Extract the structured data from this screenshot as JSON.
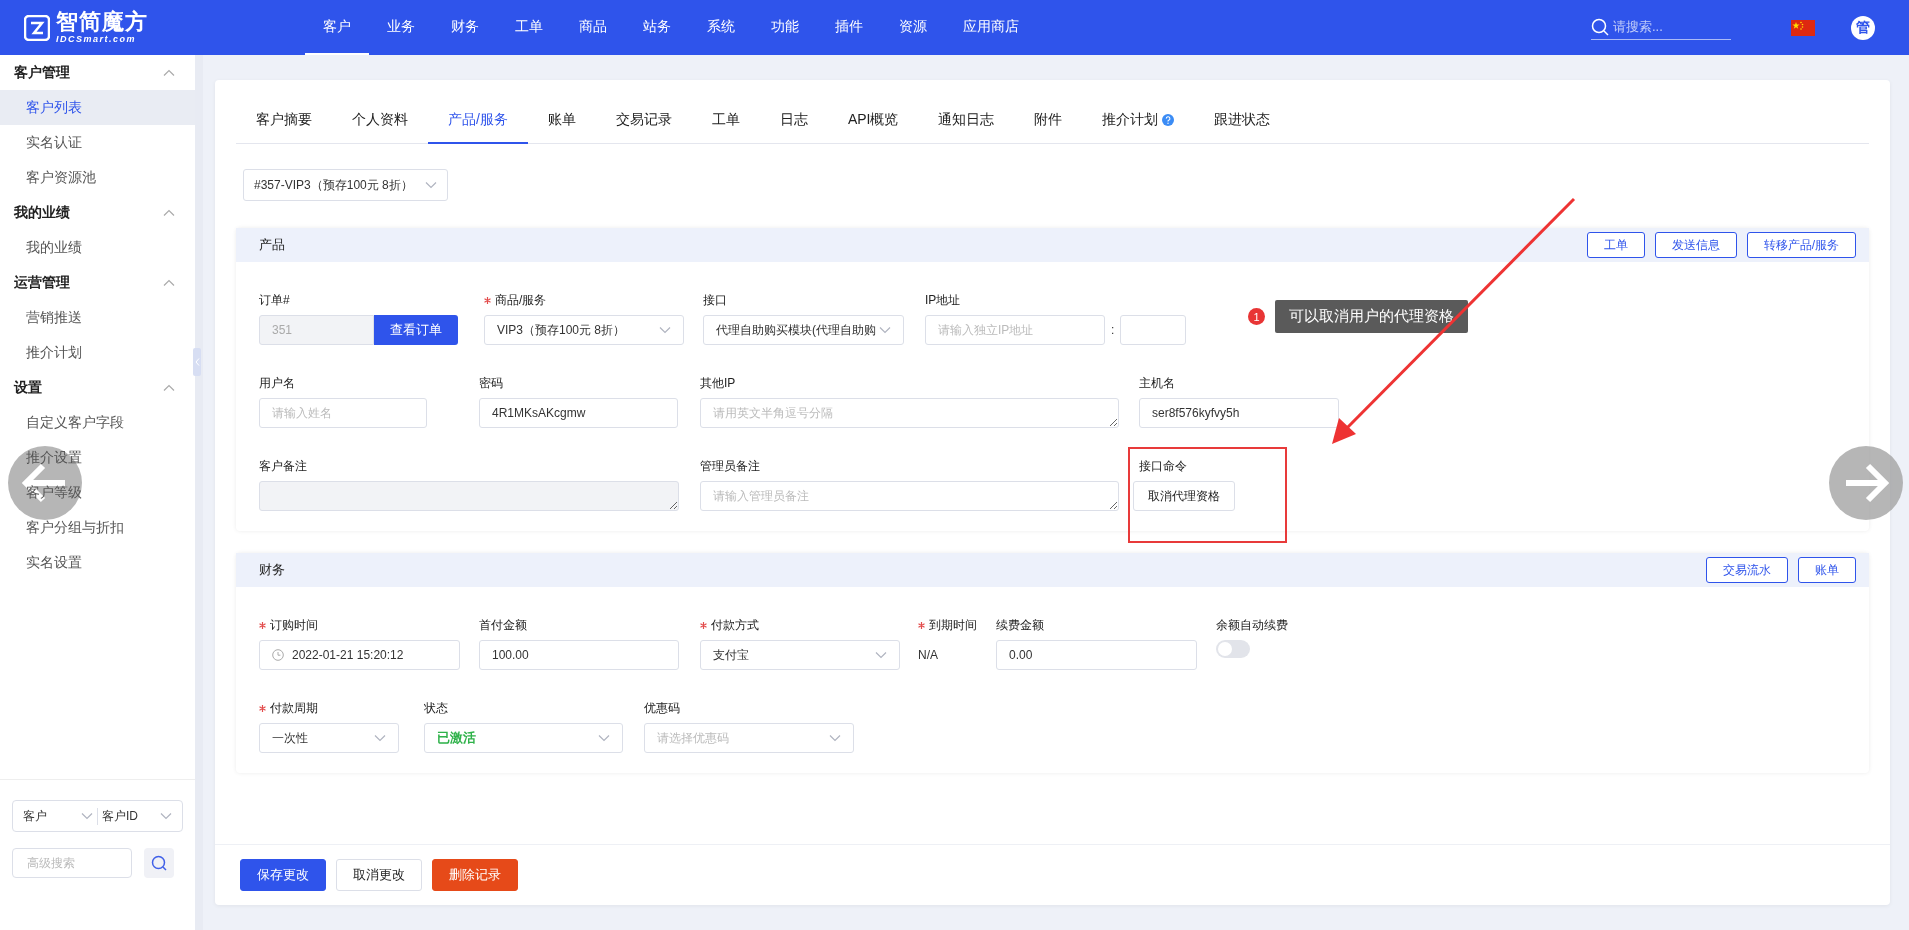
{
  "header": {
    "logo": {
      "name": "智简魔方",
      "sub": "IDCSmart.com"
    },
    "nav": [
      {
        "label": "客户",
        "selected": true
      },
      {
        "label": "业务",
        "selected": false
      },
      {
        "label": "财务",
        "selected": false
      },
      {
        "label": "工单",
        "selected": false
      },
      {
        "label": "商品",
        "selected": false
      },
      {
        "label": "站务",
        "selected": false
      },
      {
        "label": "系统",
        "selected": false
      },
      {
        "label": "功能",
        "selected": false
      },
      {
        "label": "插件",
        "selected": false
      },
      {
        "label": "资源",
        "selected": false
      },
      {
        "label": "应用商店",
        "selected": false
      }
    ],
    "search": {
      "placeholder": "请搜索..."
    },
    "avatar": "管"
  },
  "sidebar": {
    "groups": [
      {
        "title": "客户管理",
        "expanded": true,
        "items": [
          {
            "label": "客户列表",
            "selected": true
          },
          {
            "label": "实名认证",
            "selected": false
          },
          {
            "label": "客户资源池",
            "selected": false
          }
        ]
      },
      {
        "title": "我的业绩",
        "expanded": true,
        "items": [
          {
            "label": "我的业绩",
            "selected": false
          }
        ]
      },
      {
        "title": "运营管理",
        "expanded": true,
        "items": [
          {
            "label": "营销推送",
            "selected": false
          },
          {
            "label": "推介计划",
            "selected": false
          }
        ]
      },
      {
        "title": "设置",
        "expanded": true,
        "items": [
          {
            "label": "自定义客户字段",
            "selected": false
          },
          {
            "label": "推介设置",
            "selected": false
          },
          {
            "label": "客户等级",
            "selected": false
          },
          {
            "label": "客户分组与折扣",
            "selected": false
          },
          {
            "label": "实名设置",
            "selected": false
          }
        ]
      }
    ],
    "filter": {
      "type": "客户",
      "field": "客户ID",
      "placeholder": "高级搜索"
    }
  },
  "tabs": [
    {
      "label": "客户摘要",
      "selected": false,
      "help": false
    },
    {
      "label": "个人资料",
      "selected": false,
      "help": false
    },
    {
      "label": "产品/服务",
      "selected": true,
      "help": false
    },
    {
      "label": "账单",
      "selected": false,
      "help": false
    },
    {
      "label": "交易记录",
      "selected": false,
      "help": false
    },
    {
      "label": "工单",
      "selected": false,
      "help": false
    },
    {
      "label": "日志",
      "selected": false,
      "help": false
    },
    {
      "label": "API概览",
      "selected": false,
      "help": false
    },
    {
      "label": "通知日志",
      "selected": false,
      "help": false
    },
    {
      "label": "附件",
      "selected": false,
      "help": false
    },
    {
      "label": "推介计划",
      "selected": false,
      "help": true
    },
    {
      "label": "跟进状态",
      "selected": false,
      "help": false
    }
  ],
  "product_select": "#357-VIP3（预存100元 8折）",
  "sections": [
    {
      "title": "产品",
      "actions": [
        "工单",
        "发送信息",
        "转移产品/服务"
      ],
      "fields": [
        {
          "kind": "input-button",
          "label": "订单#",
          "required": false,
          "value": "351",
          "disabled": true,
          "button": "查看订单"
        },
        {
          "kind": "select",
          "label": "商品/服务",
          "required": true,
          "value": "VIP3（预存100元 8折）"
        },
        {
          "kind": "select",
          "label": "接口",
          "required": false,
          "value": "代理自助购买模块(代理自助购"
        },
        {
          "kind": "ip",
          "label": "IP地址",
          "required": false,
          "placeholder": "请输入独立IP地址",
          "separator": ":"
        },
        {
          "kind": "input",
          "label": "用户名",
          "required": false,
          "placeholder": "请输入姓名",
          "disabled": false
        },
        {
          "kind": "input",
          "label": "密码",
          "required": false,
          "value": "4R1MKsAKcgmw",
          "disabled": false
        },
        {
          "kind": "textarea",
          "label": "其他IP",
          "required": false,
          "placeholder": "请用英文半角逗号分隔",
          "disabled": false
        },
        {
          "kind": "input",
          "label": "主机名",
          "required": false,
          "value": "ser8f576kyfvy5h",
          "disabled": false
        },
        {
          "kind": "textarea",
          "label": "客户备注",
          "required": false,
          "disabled": true
        },
        {
          "kind": "textarea",
          "label": "管理员备注",
          "required": false,
          "placeholder": "请输入管理员备注",
          "disabled": false
        },
        {
          "kind": "command",
          "label": "接口命令",
          "required": false,
          "button": "取消代理资格"
        }
      ]
    },
    {
      "title": "财务",
      "actions": [
        "交易流水",
        "账单"
      ],
      "fields": [
        {
          "kind": "date",
          "label": "订购时间",
          "required": true,
          "value": "2022-01-21 15:20:12"
        },
        {
          "kind": "input",
          "label": "首付金额",
          "required": false,
          "value": "100.00",
          "disabled": false
        },
        {
          "kind": "select",
          "label": "付款方式",
          "required": true,
          "value": "支付宝"
        },
        {
          "kind": "static",
          "label": "到期时间",
          "required": true,
          "value": "N/A"
        },
        {
          "kind": "input",
          "label": "续费金额",
          "required": false,
          "value": "0.00",
          "disabled": false
        },
        {
          "kind": "toggle",
          "label": "余额自动续费",
          "required": false,
          "on": false
        },
        {
          "kind": "select",
          "label": "付款周期",
          "required": true,
          "value": "一次性"
        },
        {
          "kind": "select",
          "label": "状态",
          "required": false,
          "value": "已激活",
          "color": "#2fb24a"
        },
        {
          "kind": "select",
          "label": "优惠码",
          "required": false,
          "placeholder": "请选择优惠码"
        }
      ]
    }
  ],
  "footer": [
    {
      "label": "保存更改",
      "kind": "primary"
    },
    {
      "label": "取消更改",
      "kind": "default"
    },
    {
      "label": "删除记录",
      "kind": "danger"
    }
  ],
  "annotation": {
    "badge": "1",
    "text": "可以取消用户的代理资格"
  }
}
